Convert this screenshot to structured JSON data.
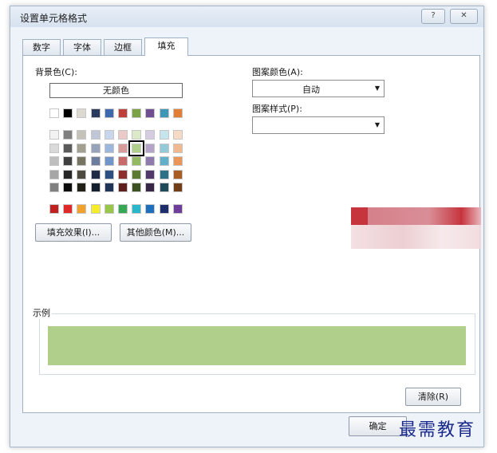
{
  "window": {
    "title": "设置单元格格式",
    "help": "?",
    "close": "✕"
  },
  "tabs": [
    {
      "label": "数字"
    },
    {
      "label": "字体"
    },
    {
      "label": "边框"
    },
    {
      "label": "填充"
    }
  ],
  "fill": {
    "background_color_label": "背景色(C):",
    "no_color": "无颜色",
    "selected_color": "#b0cf8b",
    "theme_row": [
      "#ffffff",
      "#000000",
      "#dcdad0",
      "#2a3a5e",
      "#3e69ad",
      "#bf3f3b",
      "#7ba346",
      "#6f4e91",
      "#3c98b4",
      "#e07f35"
    ],
    "tint_rows": [
      [
        "#f2f2f2",
        "#7f7f7f",
        "#c4c2b9",
        "#bfc6d6",
        "#c7d6ec",
        "#eac9c8",
        "#dbe8c9",
        "#d6cce2",
        "#c6e4ec",
        "#f7dac3"
      ],
      [
        "#d9d9d9",
        "#5a5a5a",
        "#a29e90",
        "#97a3bb",
        "#9cb6dc",
        "#d99b99",
        "#b0cf8b",
        "#b4a4c8",
        "#93c9d9",
        "#f1b98f"
      ],
      [
        "#bfbfbf",
        "#404040",
        "#767360",
        "#6d7d9e",
        "#6f95c9",
        "#c86a67",
        "#93b962",
        "#8f7aae",
        "#5fb0c8",
        "#e99658"
      ],
      [
        "#a6a6a6",
        "#262626",
        "#4d4b3f",
        "#1f2a45",
        "#2e4f82",
        "#8d2f2c",
        "#5b7b33",
        "#52396b",
        "#2b7187",
        "#a75d24"
      ],
      [
        "#808080",
        "#0d0d0d",
        "#222118",
        "#15202f",
        "#1e3557",
        "#5f1f1d",
        "#3d5222",
        "#372647",
        "#1d4b5a",
        "#703e18"
      ]
    ],
    "standard_row": [
      "#c0201f",
      "#e02828",
      "#f3a12a",
      "#f4ec27",
      "#98c54a",
      "#34a853",
      "#2ab7c9",
      "#1f6fbf",
      "#1d2d6e",
      "#6f3d9a"
    ],
    "fill_effects_button": "填充效果(I)...",
    "more_colors_button": "其他颜色(M)...",
    "pattern_color_label": "图案颜色(A):",
    "pattern_color_value": "自动",
    "pattern_style_label": "图案样式(P):",
    "pattern_style_value": "",
    "sample_label": "示例",
    "clear_button": "清除(R)",
    "ok_button": "确定"
  },
  "watermark": "最需教育"
}
